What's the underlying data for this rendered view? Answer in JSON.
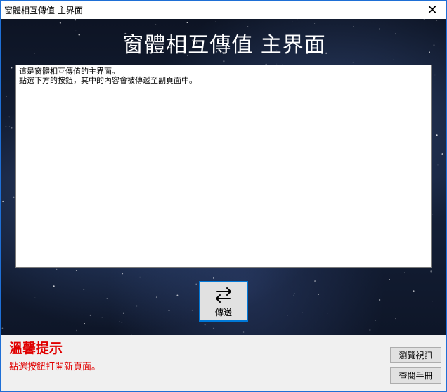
{
  "window": {
    "title": "窗體相互傳值 主界面",
    "close_glyph": "✕"
  },
  "main": {
    "heading": "窗體相互傳值 主界面",
    "textarea_value": "這是窗體相互傳值的主界面。\n點選下方的按鈕，其中的內容會被傳遞至副頁面中。"
  },
  "send_button": {
    "label": "傳送",
    "icon": "swap-arrows-icon"
  },
  "tip": {
    "heading": "溫馨提示",
    "text": "點選按鈕打開新頁面。",
    "color": "#e00000"
  },
  "side_buttons": {
    "browse_label": "瀏覽視訊",
    "manual_label": "查閱手冊"
  },
  "colors": {
    "accent": "#0078d7",
    "window_border": "#1e6fd6"
  }
}
